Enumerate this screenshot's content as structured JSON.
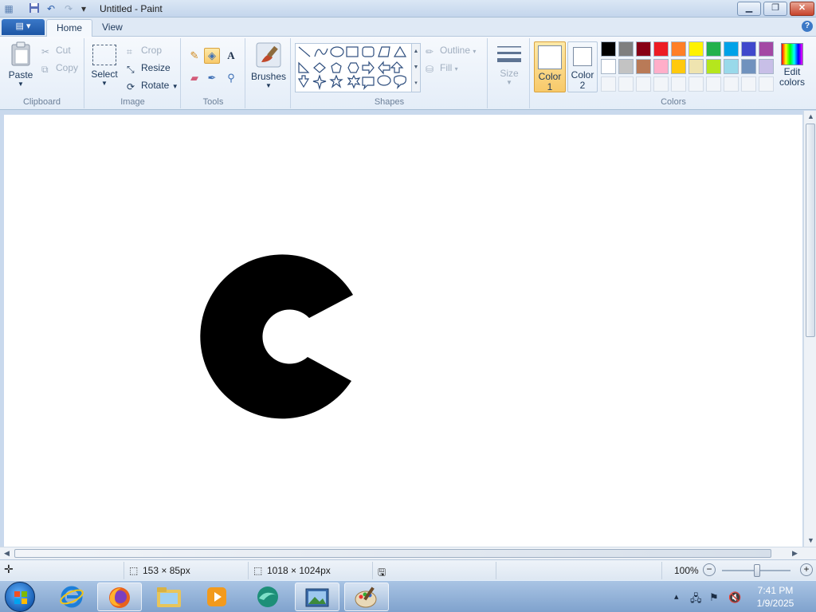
{
  "window": {
    "title": "Untitled - Paint",
    "quick_access": [
      "save-icon",
      "undo-icon",
      "redo-icon",
      "customize-dropdown-icon"
    ],
    "controls": [
      "minimize",
      "maximize",
      "close"
    ]
  },
  "tabs": [
    {
      "label": "Home",
      "active": true
    },
    {
      "label": "View",
      "active": false
    }
  ],
  "ribbon": {
    "clipboard": {
      "group_label": "Clipboard",
      "paste": "Paste",
      "cut": "Cut",
      "copy": "Copy"
    },
    "image": {
      "group_label": "Image",
      "select": "Select",
      "crop": "Crop",
      "resize": "Resize",
      "rotate": "Rotate"
    },
    "tools": {
      "group_label": "Tools",
      "items": [
        "pencil-icon",
        "fill-icon",
        "text-icon",
        "eraser-icon",
        "color-picker-icon",
        "magnifier-icon"
      ]
    },
    "brushes": {
      "label": "Brushes"
    },
    "shapes": {
      "group_label": "Shapes",
      "outline": "Outline",
      "fill": "Fill"
    },
    "size": {
      "label": "Size"
    },
    "colors": {
      "group_label": "Colors",
      "color1": {
        "label_line1": "Color",
        "label_line2": "1",
        "value": "#ffffff"
      },
      "color2": {
        "label_line1": "Color",
        "label_line2": "2",
        "value": "#ffffff"
      },
      "edit_line1": "Edit",
      "edit_line2": "colors",
      "palette_row1": [
        "#000000",
        "#7f7f7f",
        "#880015",
        "#ed1c24",
        "#ff7f27",
        "#fff200",
        "#22b14c",
        "#00a2e8",
        "#3f48cc",
        "#a349a4"
      ],
      "palette_row2": [
        "#ffffff",
        "#c3c3c3",
        "#b97a57",
        "#ffaec9",
        "#ffc90e",
        "#efe4b0",
        "#b5e61d",
        "#99d9ea",
        "#7092be",
        "#c8bfe7"
      ]
    }
  },
  "statusbar": {
    "selection_size": "153 × 85px",
    "image_size": "1018 × 1024px",
    "zoom": "100%"
  },
  "taskbar": {
    "apps": [
      "internet-explorer-icon",
      "firefox-icon",
      "file-explorer-icon",
      "media-player-icon",
      "browser-app-icon",
      "photo-viewer-icon",
      "paint-icon"
    ],
    "time": "7:41 PM",
    "date": "1/9/2025"
  }
}
